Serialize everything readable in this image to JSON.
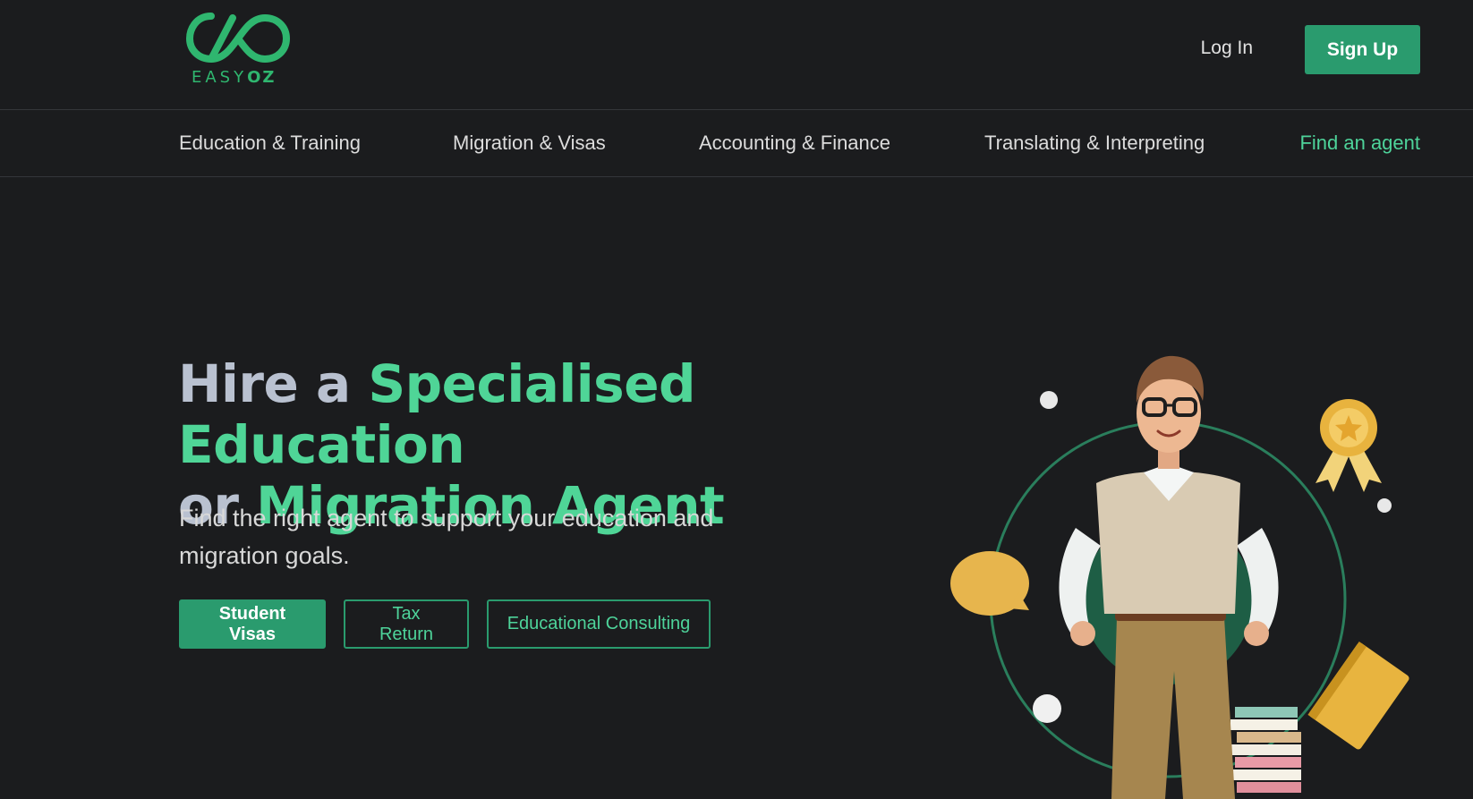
{
  "brand": {
    "logo_text_light": "EASY",
    "logo_text_bold": "OZ",
    "accent_color": "#2a9b6e",
    "highlight_color": "#4fd597",
    "background_color": "#1b1c1e"
  },
  "header": {
    "login_label": "Log In",
    "signup_label": "Sign Up"
  },
  "nav": {
    "items": [
      {
        "label": "Education & Training"
      },
      {
        "label": "Migration & Visas"
      },
      {
        "label": "Accounting & Finance"
      },
      {
        "label": "Translating & Interpreting"
      }
    ],
    "find_agent_label": "Find an agent"
  },
  "hero": {
    "title_part1": "Hire a ",
    "title_part2": "Specialised Education",
    "title_part3": "or ",
    "title_part4": "Migration Agent",
    "subtitle": "Find the right agent to support your education and migration goals.",
    "buttons": {
      "student_visas": "Student Visas",
      "tax_return": "Tax Return",
      "educational_consulting": "Educational Consulting"
    }
  },
  "illustration": {
    "icon": "student-character-illustration"
  }
}
